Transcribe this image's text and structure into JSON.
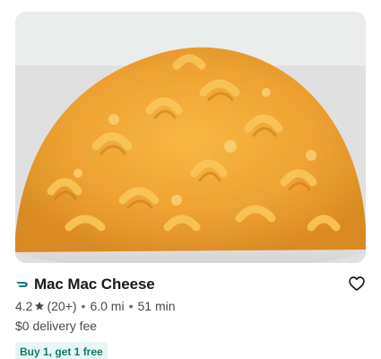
{
  "store": {
    "name": "Mac Mac Cheese",
    "rating": "4.2",
    "review_count": "(20+)",
    "distance": "6.0 mi",
    "eta": "51 min",
    "delivery_fee": "$0 delivery fee",
    "promo": "Buy 1, get 1 free",
    "meta_separator": "•"
  },
  "icons": {
    "logo": "dashpass-icon",
    "rating": "star-icon",
    "save": "heart-outline-icon"
  },
  "colors": {
    "title": "#191919",
    "meta": "#494949",
    "promo_text": "#0f7a6c",
    "promo_bg": "#e9f6f4",
    "dashpass": "#1a7a8a"
  }
}
